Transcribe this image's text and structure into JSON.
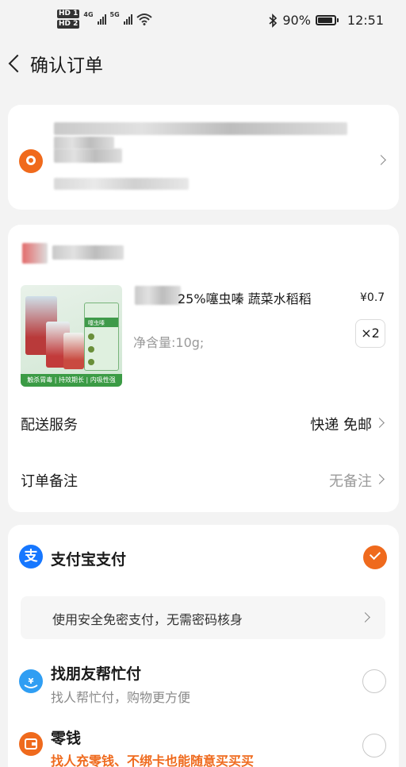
{
  "status_bar": {
    "hd1": "HD 1",
    "hd2": "HD 2",
    "network1": "4G",
    "network2": "5G",
    "battery": "90%",
    "time": "12:51"
  },
  "header": {
    "title": "确认订单"
  },
  "product": {
    "name_visible": "25%噻虫嗪 蔬菜水稻稻",
    "price": "¥0.7",
    "spec": "净含量:10g;",
    "quantity": "×2",
    "image_texts": {
      "panel_title": "噻虫嗪",
      "banner": "触杀胃毒 | 持效期长 | 内吸性强"
    }
  },
  "delivery": {
    "label": "配送服务",
    "value": "快递 免邮"
  },
  "remark": {
    "label": "订单备注",
    "value": "无备注"
  },
  "payment": {
    "alipay": {
      "icon_glyph": "支",
      "label": "支付宝支付",
      "tip": "使用安全免密支付，无需密码核身"
    },
    "friend_pay": {
      "title": "找朋友帮忙付",
      "subtitle": "找人帮忙付，购物更方便"
    },
    "change": {
      "title": "零钱",
      "subtitle": "找人充零钱、不绑卡也能随意买买买"
    }
  },
  "colors": {
    "accent": "#ef6a1d",
    "alipay_blue": "#1677ff",
    "page_bg": "#f3f3f3"
  }
}
